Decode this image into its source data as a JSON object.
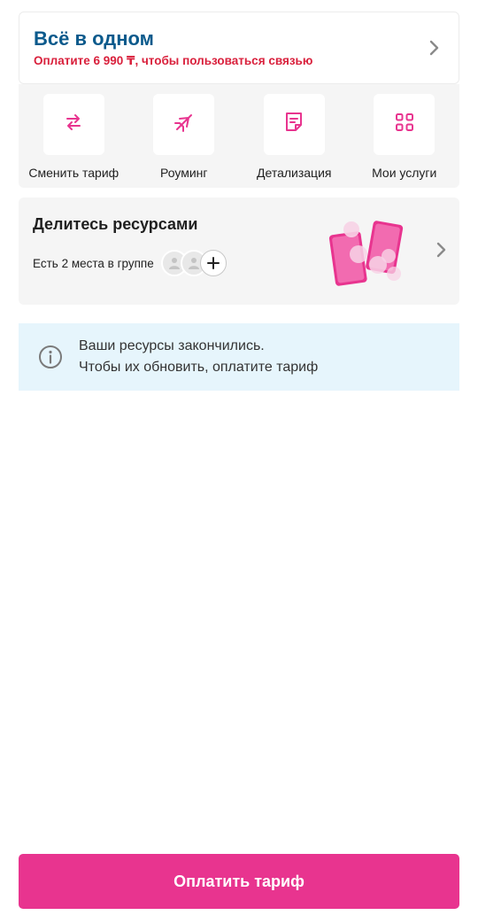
{
  "tariff": {
    "title": "Всё в одном",
    "subtitle": "Оплатите 6 990 ₸, чтобы пользоваться связью"
  },
  "actions": [
    {
      "label": "Сменить тариф",
      "icon": "swap-arrows-icon"
    },
    {
      "label": "Роуминг",
      "icon": "airplane-icon"
    },
    {
      "label": "Детализация",
      "icon": "document-icon"
    },
    {
      "label": "Мои услуги",
      "icon": "grid-icon"
    }
  ],
  "share": {
    "title": "Делитесь ресурсами",
    "subtitle": "Есть 2 места в группе"
  },
  "info": {
    "line1": "Ваши ресурсы закончились.",
    "line2": "Чтобы их обновить, оплатите тариф"
  },
  "pay_button": {
    "label": "Оплатить тариф"
  },
  "colors": {
    "accent": "#e8348f",
    "title_blue": "#0b5a8c",
    "warning_red": "#d9203c",
    "info_bg": "#e6f5fc"
  }
}
